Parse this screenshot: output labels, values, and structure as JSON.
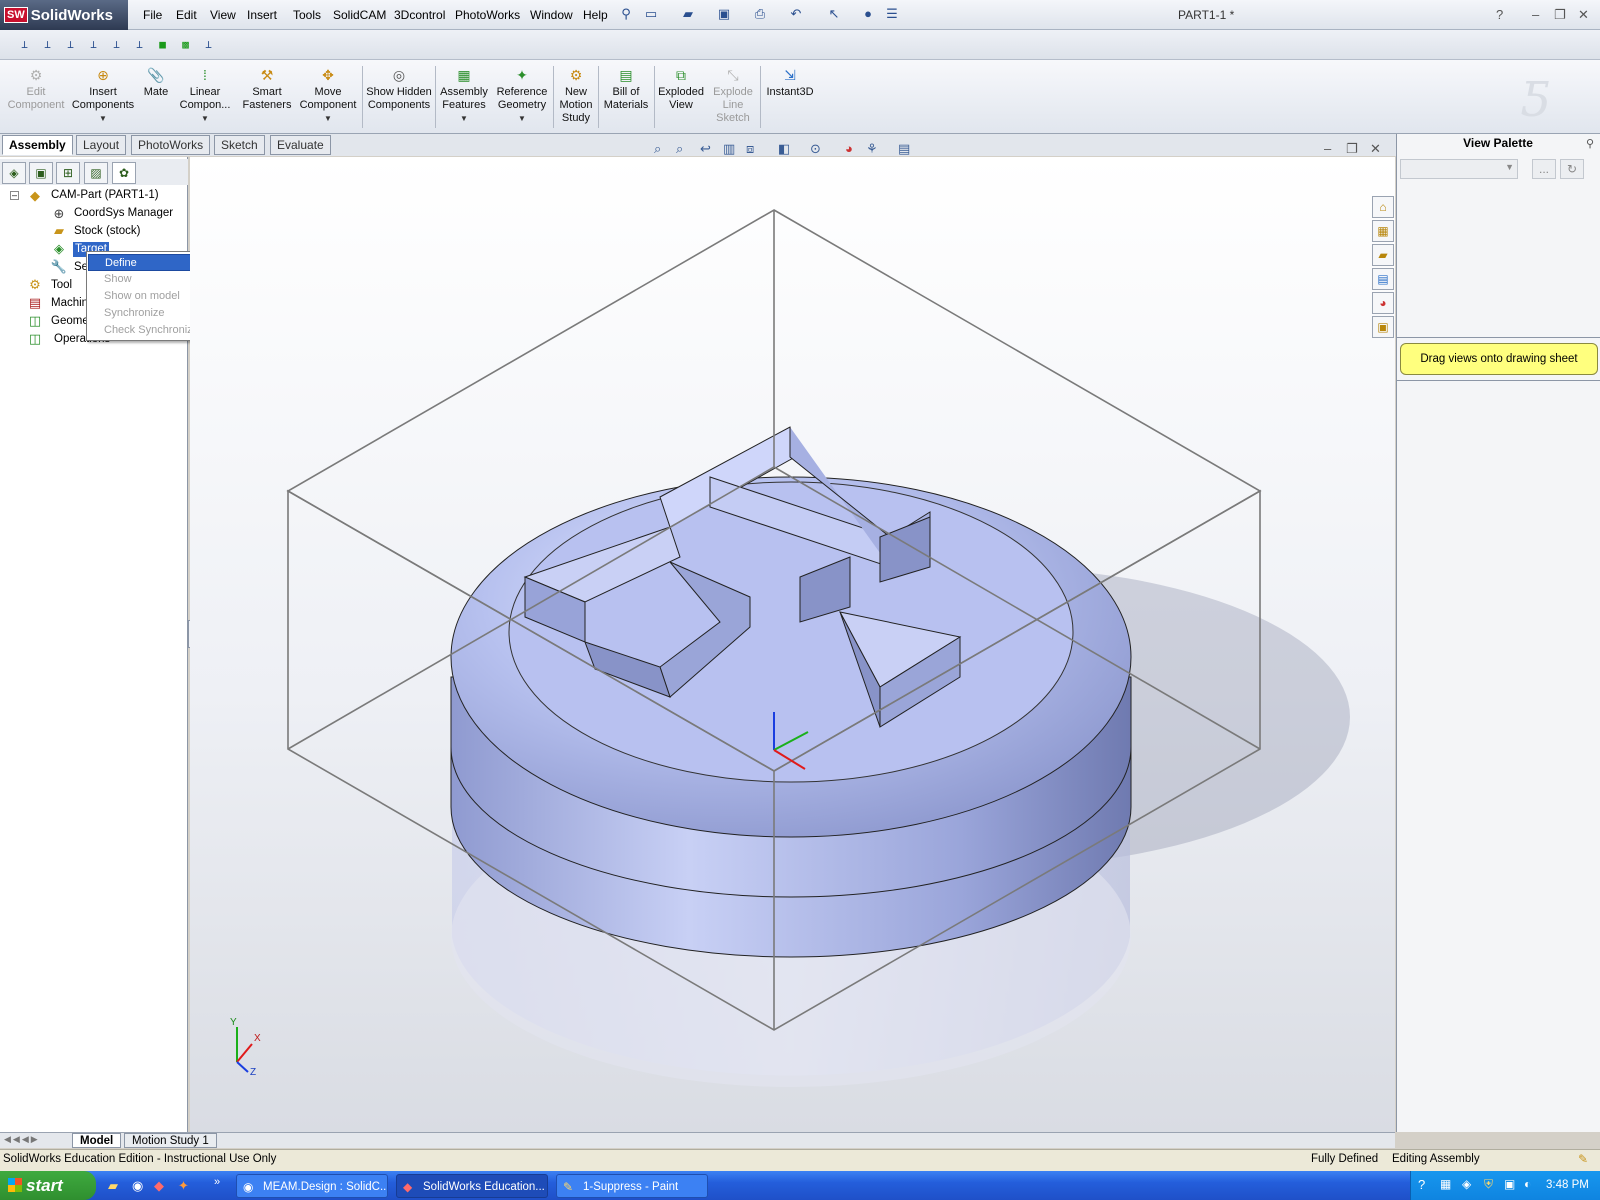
{
  "app": {
    "logo": "SolidWorks",
    "doc_title": "PART1-1 *"
  },
  "menu": [
    "File",
    "Edit",
    "View",
    "Insert",
    "Tools",
    "SolidCAM",
    "3Dcontrol",
    "PhotoWorks",
    "Window",
    "Help"
  ],
  "command_manager": {
    "buttons": [
      {
        "label": "Edit Component",
        "enabled": false
      },
      {
        "label": "Insert Components",
        "enabled": true
      },
      {
        "label": "Mate",
        "enabled": true
      },
      {
        "label": "Linear Compon...",
        "enabled": true
      },
      {
        "label": "Smart Fasteners",
        "enabled": true
      },
      {
        "label": "Move Component",
        "enabled": true
      },
      {
        "label": "Show Hidden Components",
        "enabled": true
      },
      {
        "label": "Assembly Features",
        "enabled": true
      },
      {
        "label": "Reference Geometry",
        "enabled": true
      },
      {
        "label": "New Motion Study",
        "enabled": true
      },
      {
        "label": "Bill of Materials",
        "enabled": true
      },
      {
        "label": "Exploded View",
        "enabled": true
      },
      {
        "label": "Explode Line Sketch",
        "enabled": false
      },
      {
        "label": "Instant3D",
        "enabled": true
      }
    ]
  },
  "tabs": [
    "Assembly",
    "Layout",
    "PhotoWorks",
    "Sketch",
    "Evaluate"
  ],
  "active_tab": "Assembly",
  "tree": {
    "root": "CAM-Part (PART1-1)",
    "items": [
      "CoordSys Manager",
      "Stock (stock)",
      "Target",
      "Se",
      "Tool",
      "Machin",
      "Geome",
      "Operations"
    ]
  },
  "context_menu": {
    "items": [
      {
        "label": "Define",
        "enabled": true
      },
      {
        "label": "Show",
        "enabled": false
      },
      {
        "label": "Show on model",
        "enabled": false
      },
      {
        "label": "Synchronize",
        "enabled": false
      },
      {
        "label": "Check Synchronization",
        "enabled": false
      }
    ]
  },
  "view_palette": {
    "title": "View Palette",
    "hint": "Drag views onto drawing sheet",
    "more_button": "..."
  },
  "bottom_tabs": [
    "Model",
    "Motion Study 1"
  ],
  "status": {
    "left": "SolidWorks Education Edition - Instructional Use Only",
    "defined": "Fully Defined",
    "mode": "Editing Assembly"
  },
  "taskbar": {
    "start": "start",
    "tasks": [
      "MEAM.Design : SolidC...",
      "SolidWorks Education...",
      "1-Suppress - Paint"
    ],
    "clock": "3:48 PM"
  },
  "triad_axes": [
    "Y",
    "X",
    "Z"
  ],
  "colors": {
    "selection": "#2f66c7",
    "part": "#a8b4e8",
    "note": "#ffff7e",
    "taskbar": "#245edb"
  }
}
